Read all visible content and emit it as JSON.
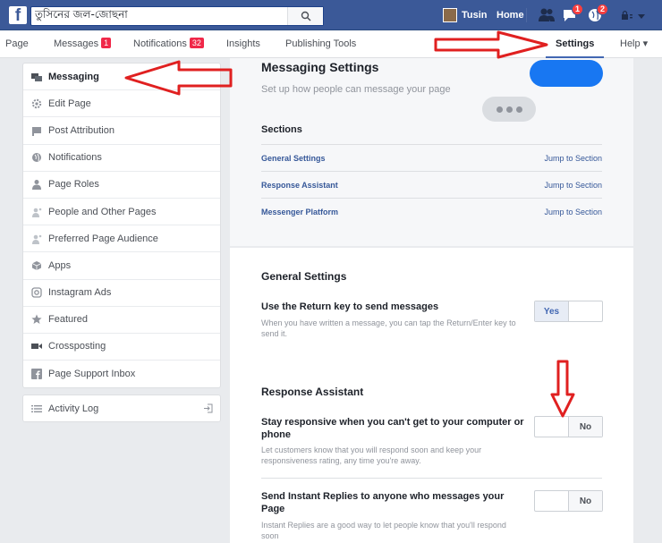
{
  "topbar": {
    "search_value": "তুসিনের জল-জোছনা",
    "user_name": "Tusin",
    "home_label": "Home",
    "friend_badge": "",
    "messages_badge": "1",
    "notifications_badge": "2"
  },
  "pagenav": {
    "page": "Page",
    "messages": "Messages",
    "messages_badge": "1",
    "notifications": "Notifications",
    "notifications_badge": "32",
    "insights": "Insights",
    "publishing": "Publishing Tools",
    "settings": "Settings",
    "help": "Help ▾"
  },
  "sidebar": {
    "items": [
      {
        "label": "Messaging"
      },
      {
        "label": "Edit Page"
      },
      {
        "label": "Post Attribution"
      },
      {
        "label": "Notifications"
      },
      {
        "label": "Page Roles"
      },
      {
        "label": "People and Other Pages"
      },
      {
        "label": "Preferred Page Audience"
      },
      {
        "label": "Apps"
      },
      {
        "label": "Instagram Ads"
      },
      {
        "label": "Featured"
      },
      {
        "label": "Crossposting"
      },
      {
        "label": "Page Support Inbox"
      }
    ],
    "activity_log": "Activity Log"
  },
  "main": {
    "title": "Messaging Settings",
    "subtitle": "Set up how people can message your page",
    "sections_heading": "Sections",
    "sections": [
      {
        "name": "General Settings",
        "jump": "Jump to Section"
      },
      {
        "name": "Response Assistant",
        "jump": "Jump to Section"
      },
      {
        "name": "Messenger Platform",
        "jump": "Jump to Section"
      }
    ],
    "general": {
      "heading": "General Settings",
      "return_title": "Use the Return key to send messages",
      "return_desc": "When you have written a message, you can tap the Return/Enter key to send it.",
      "return_toggle": "Yes"
    },
    "response": {
      "heading": "Response Assistant",
      "stay_title": "Stay responsive when you can't get to your computer or phone",
      "stay_desc": "Let customers know that you will respond soon and keep your responsiveness rating, any time you're away.",
      "stay_toggle": "No",
      "instant_title": "Send Instant Replies to anyone who messages your Page",
      "instant_desc": "Instant Replies are a good way to let people know that you'll respond soon",
      "instant_toggle": "No"
    }
  },
  "colors": {
    "brand": "#3b5998",
    "accent": "#1877f2",
    "annotation_arrow": "#e02020"
  }
}
